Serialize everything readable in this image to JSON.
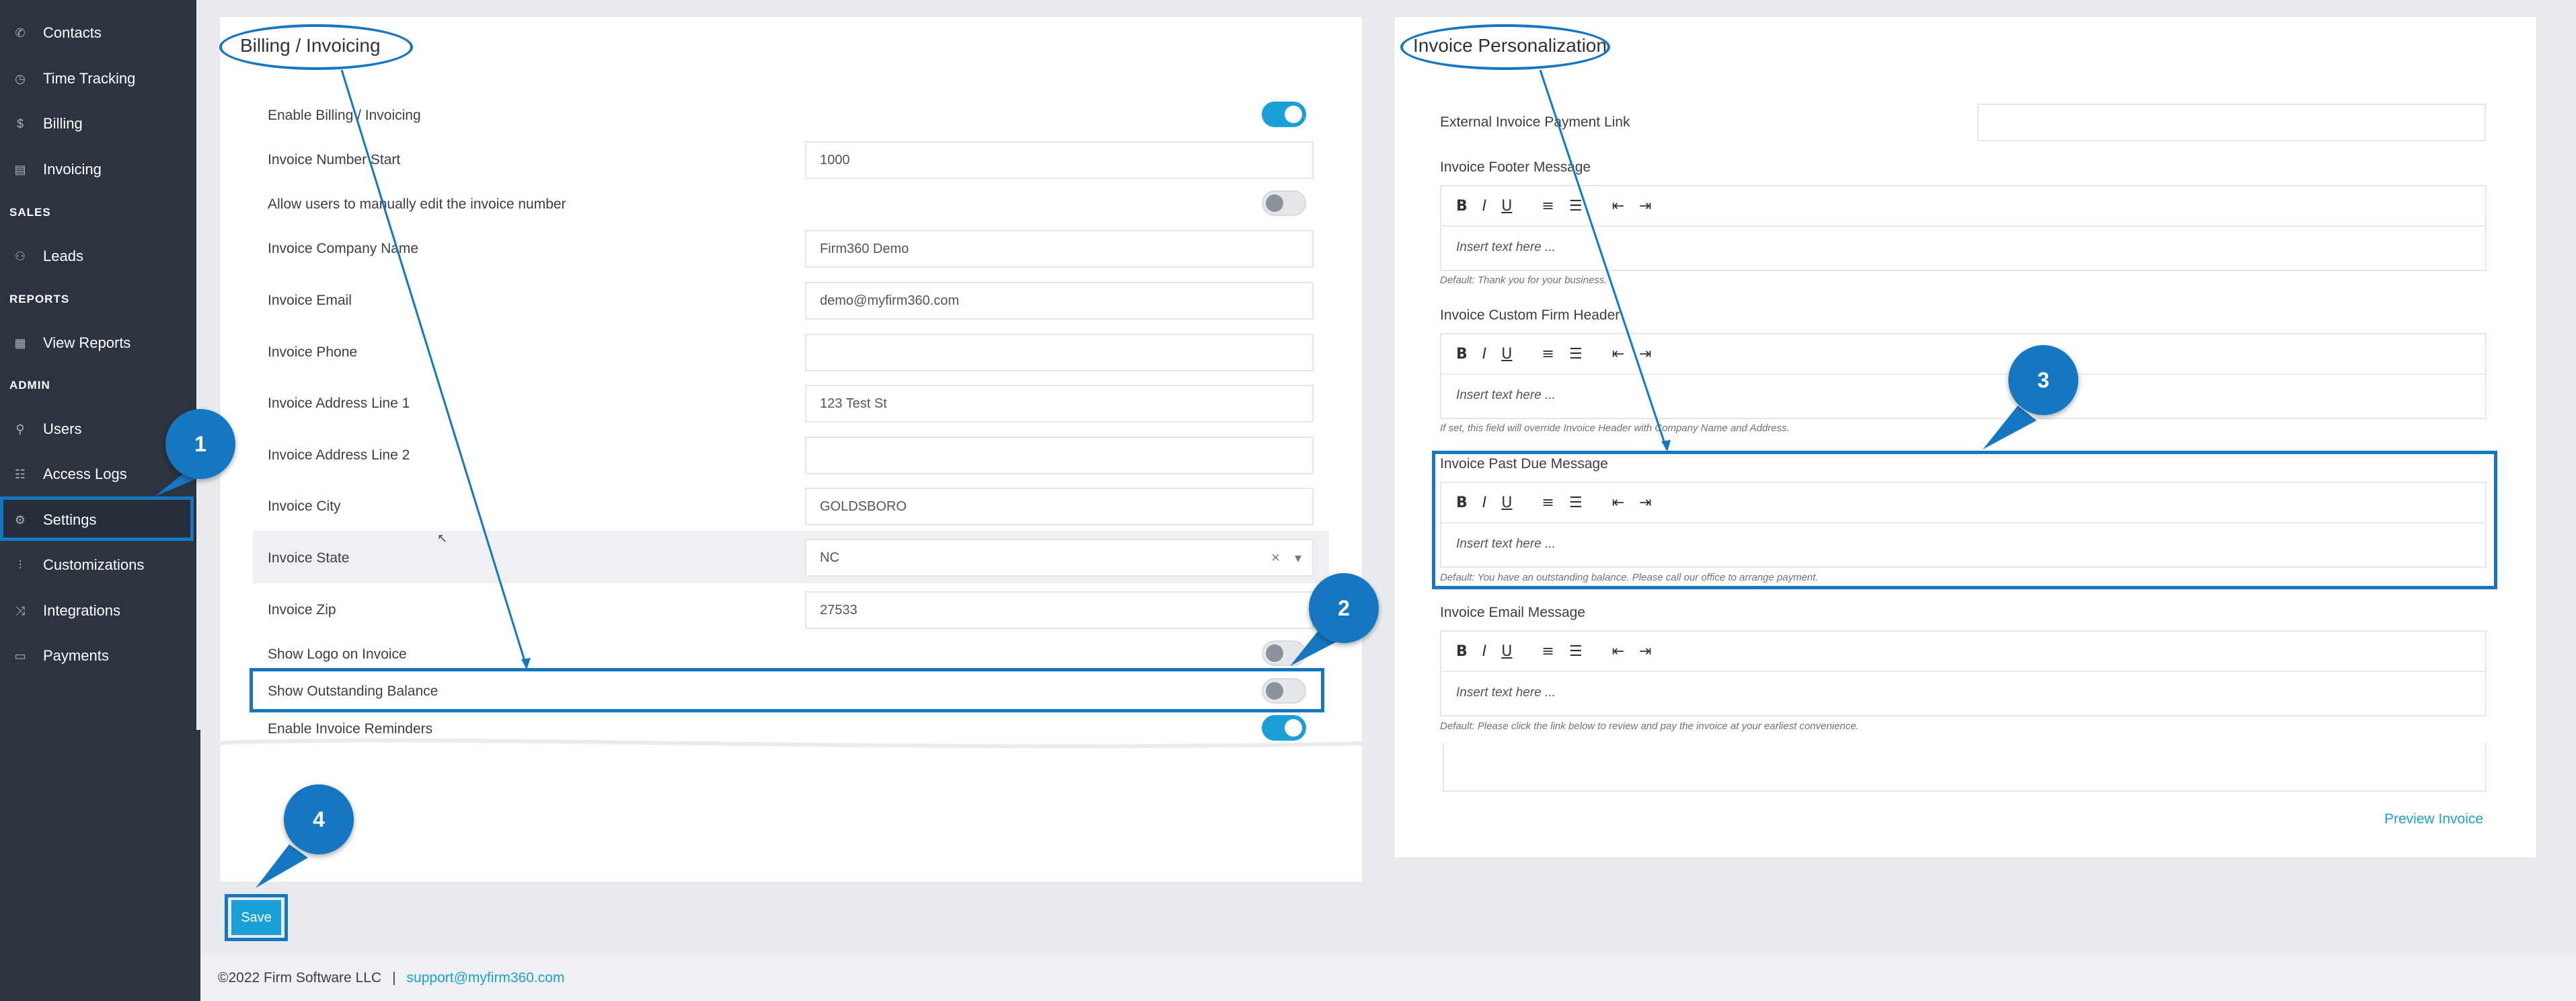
{
  "sidebar": {
    "items": [
      {
        "label": "Contacts",
        "icon": "phone-icon"
      },
      {
        "label": "Time Tracking",
        "icon": "clock-icon"
      },
      {
        "label": "Billing",
        "icon": "dollar-icon"
      },
      {
        "label": "Invoicing",
        "icon": "document-icon"
      },
      {
        "label": "Leads",
        "icon": "user-plus-icon"
      },
      {
        "label": "View Reports",
        "icon": "calendar-icon"
      },
      {
        "label": "Users",
        "icon": "user-icon"
      },
      {
        "label": "Access Logs",
        "icon": "log-icon"
      },
      {
        "label": "Settings",
        "icon": "gear-icon"
      },
      {
        "label": "Customizations",
        "icon": "sliders-icon"
      },
      {
        "label": "Integrations",
        "icon": "shuffle-icon"
      },
      {
        "label": "Payments",
        "icon": "card-icon"
      }
    ],
    "sections": {
      "sales": "SALES",
      "reports": "REPORTS",
      "admin": "ADMIN"
    }
  },
  "billing": {
    "title": "Billing / Invoicing",
    "rows": {
      "enable_billing": {
        "label": "Enable Billing / Invoicing",
        "on": true
      },
      "number_start": {
        "label": "Invoice Number Start",
        "value": "1000"
      },
      "allow_edit": {
        "label": "Allow users to manually edit the invoice number",
        "on": false
      },
      "company_name": {
        "label": "Invoice Company Name",
        "value": "Firm360 Demo"
      },
      "email": {
        "label": "Invoice Email",
        "value": "demo@myfirm360.com"
      },
      "phone": {
        "label": "Invoice Phone",
        "value": ""
      },
      "address1": {
        "label": "Invoice Address Line 1",
        "value": "123 Test St"
      },
      "address2": {
        "label": "Invoice Address Line 2",
        "value": ""
      },
      "city": {
        "label": "Invoice City",
        "value": "GOLDSBORO"
      },
      "state": {
        "label": "Invoice State",
        "value": "NC",
        "clear": "×",
        "caret": "▾"
      },
      "zip": {
        "label": "Invoice Zip",
        "value": "27533"
      },
      "show_logo": {
        "label": "Show Logo on Invoice",
        "on": false
      },
      "show_balance": {
        "label": "Show Outstanding Balance",
        "on": false
      },
      "reminders": {
        "label": "Enable Invoice Reminders",
        "on": true
      }
    }
  },
  "personalization": {
    "title": "Invoice Personalization",
    "payment_link": {
      "label": "External Invoice Payment Link",
      "value": ""
    },
    "toolbar": {
      "bold": "B",
      "italic": "I",
      "underline": "U",
      "ordered": "≡",
      "bullets": "☰",
      "outdent": "⇤",
      "indent": "⇥"
    },
    "placeholder": "Insert text here ...",
    "footer": {
      "label": "Invoice Footer Message",
      "hint": "Default: Thank you for your business."
    },
    "header": {
      "label": "Invoice Custom Firm Header",
      "hint": "If set, this field will override Invoice Header with Company Name and Address."
    },
    "past_due": {
      "label": "Invoice Past Due Message",
      "hint": "Default: You have an outstanding balance. Please call our office to arrange payment."
    },
    "email_msg": {
      "label": "Invoice Email Message",
      "hint": "Default: Please click the link below to review and pay the invoice at your earliest convenience."
    },
    "preview": "Preview Invoice"
  },
  "actions": {
    "save": "Save"
  },
  "footer": {
    "copyright": "©2022 Firm Software LLC",
    "separator": "|",
    "support": "support@myfirm360.com"
  },
  "annotations": [
    "1",
    "2",
    "3",
    "4"
  ],
  "colors": {
    "accent": "#1a9fd6",
    "annotation": "#1577c1",
    "sidebar": "#2c3440"
  }
}
